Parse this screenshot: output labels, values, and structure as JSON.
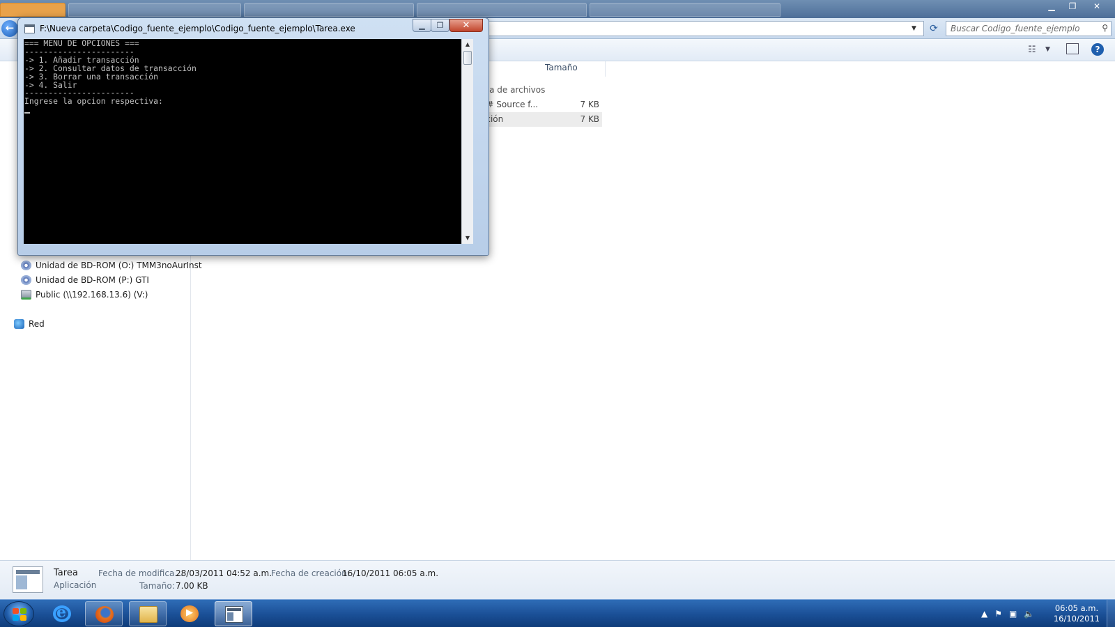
{
  "explorer": {
    "search": {
      "placeholder": "Buscar Codigo_fuente_ejemplo"
    },
    "column_header": "Tamaño",
    "group_label": "eta de archivos",
    "files": [
      {
        "type": "C# Source f...",
        "size": "7 KB"
      },
      {
        "type": "ación",
        "size": "7 KB"
      }
    ],
    "nav_items": [
      {
        "label": "Unidad de BD-ROM (O:) TMM3noAurInst",
        "icon": "bdrom-drive-icon"
      },
      {
        "label": "Unidad de BD-ROM (P:) GTI",
        "icon": "bdrom-drive-icon"
      },
      {
        "label": "Public (\\\\192.168.13.6) (V:)",
        "icon": "network-drive-icon"
      },
      {
        "label": "Red",
        "icon": "network-icon"
      }
    ],
    "details": {
      "name": "Tarea",
      "kind": "Aplicación",
      "modified_label": "Fecha de modifica...",
      "modified_value": "28/03/2011 04:52 a.m.",
      "created_label": "Fecha de creación:",
      "created_value": "16/10/2011 06:05 a.m.",
      "size_label": "Tamaño:",
      "size_value": "7.00 KB"
    }
  },
  "console": {
    "title": "F:\\Nueva carpeta\\Codigo_fuente_ejemplo\\Codigo_fuente_ejemplo\\Tarea.exe",
    "lines": [
      "=== MENU DE OPCIONES ===",
      "-----------------------",
      "-> 1. Añadir transacción",
      "-> 2. Consultar datos de transacción",
      "-> 3. Borrar una transacción",
      "-> 4. Salir",
      "-----------------------",
      "Ingrese la opcion respectiva:"
    ]
  },
  "taskbar": {
    "clock_time": "06:05 a.m.",
    "clock_date": "16/10/2011",
    "apps": [
      {
        "name": "internet-explorer",
        "state": "pinned"
      },
      {
        "name": "firefox",
        "state": "running"
      },
      {
        "name": "windows-explorer",
        "state": "running"
      },
      {
        "name": "media-player",
        "state": "pinned"
      },
      {
        "name": "tarea-console",
        "state": "active"
      }
    ]
  },
  "colors": {
    "console_bg": "#000000",
    "console_text": "#c0c0c0",
    "taskbar": "#1a4f96",
    "close_button": "#c1452c"
  }
}
